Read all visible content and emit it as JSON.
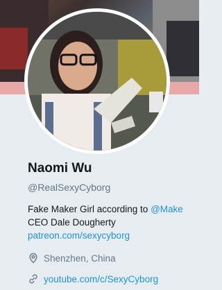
{
  "profile": {
    "name": "Naomi Wu",
    "handle": "@RealSexyCyborg",
    "bio": {
      "text_before_mention": "Fake Maker Girl according to ",
      "mention": "@Make",
      "line2": "CEO Dale Dougherty",
      "link": "patreon.com/sexycyborg"
    },
    "location": "Shenzhen, China",
    "website": "youtube.com/c/SexyCyborg"
  },
  "icons": {
    "location": "location-pin-icon",
    "website": "link-icon"
  },
  "colors": {
    "link": "#1b95e0",
    "background": "#e6ecf0",
    "secondary_text": "#657786",
    "primary_text": "#14171a"
  }
}
